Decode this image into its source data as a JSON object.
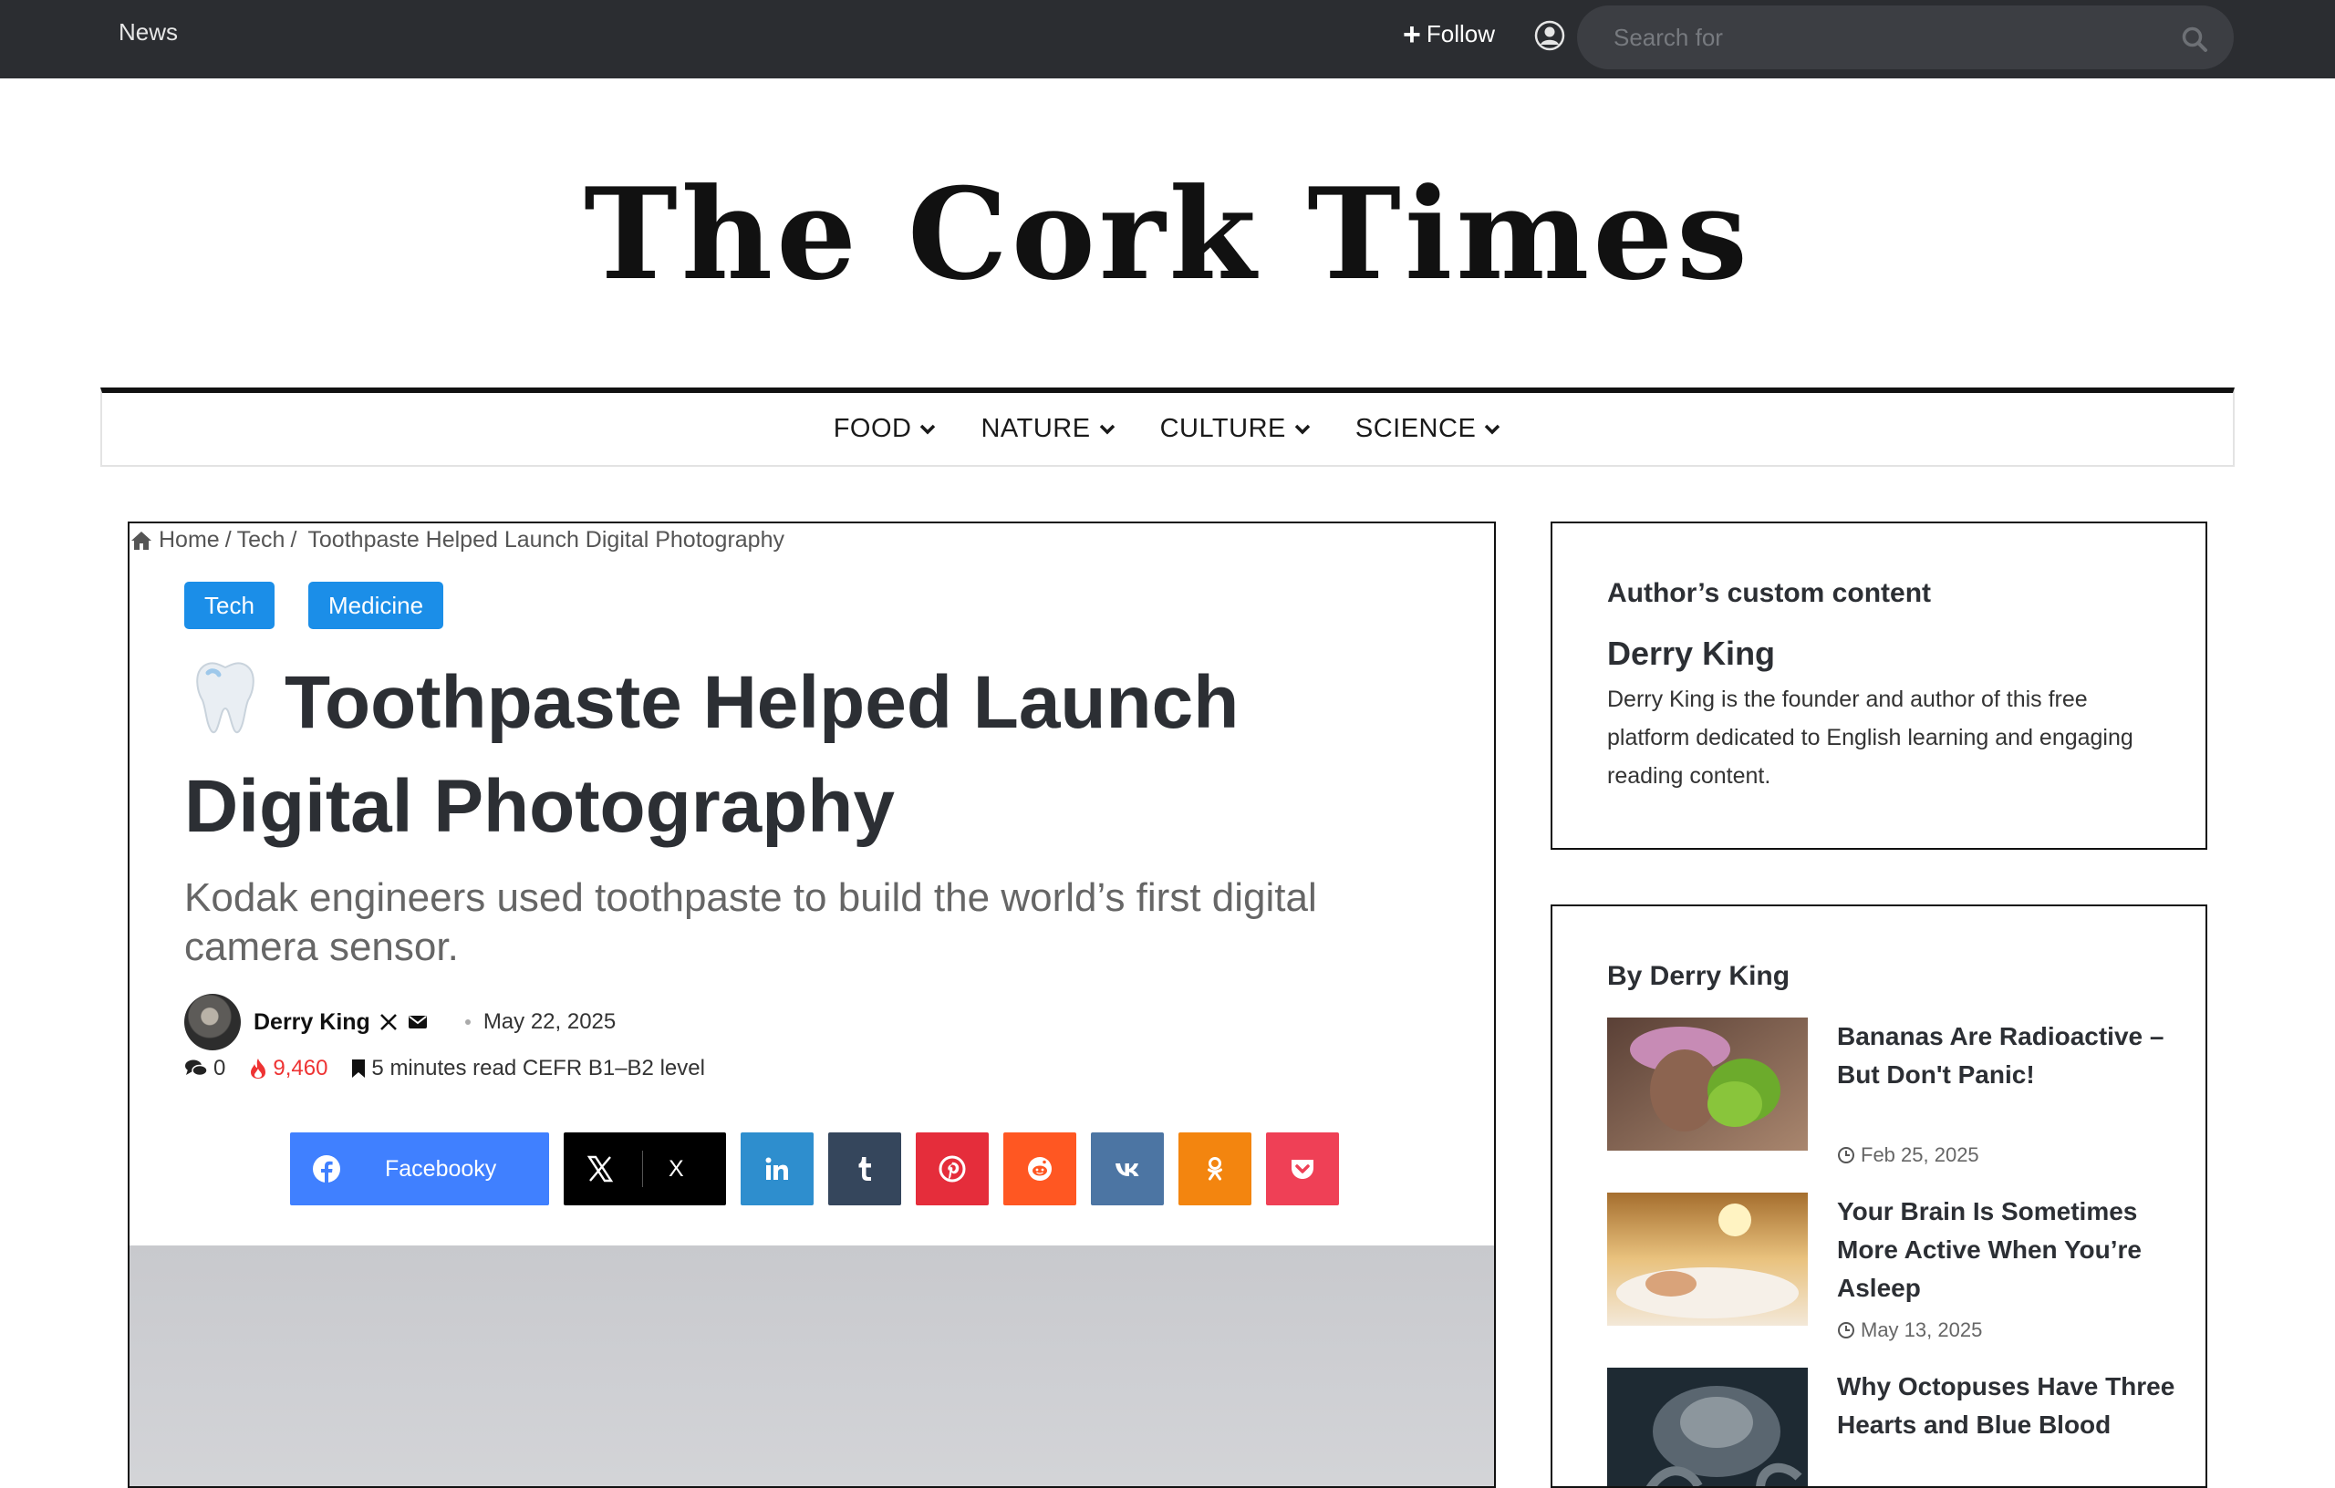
{
  "topbar": {
    "news_label": "News",
    "follow_label": "Follow",
    "search_placeholder": "Search for"
  },
  "site": {
    "logo_text": "The Cork Times"
  },
  "nav": {
    "items": [
      {
        "label": "FOOD"
      },
      {
        "label": "NATURE"
      },
      {
        "label": "CULTURE"
      },
      {
        "label": "SCIENCE"
      }
    ]
  },
  "breadcrumb": {
    "home": "Home",
    "sep1": "/",
    "section": "Tech",
    "sep2": "/",
    "current": "Toothpaste Helped Launch Digital Photography"
  },
  "article": {
    "tags": [
      "Tech",
      "Medicine"
    ],
    "title": "Toothpaste Helped Launch Digital Photography",
    "subtitle": "Kodak engineers used toothpaste to build the world’s first digital camera sensor.",
    "author": "Derry King",
    "date": "May 22, 2025",
    "comments": "0",
    "views": "9,460",
    "read_time": "5 minutes read CEFR B1–B2 level",
    "share": {
      "facebook_label": "Facebooky",
      "x_label": "X"
    }
  },
  "colors": {
    "topbar_bg": "#2b2d31",
    "tag_blue": "#1b8ee8",
    "facebook": "#4080ff",
    "x": "#000000",
    "linkedin": "#2e8ece",
    "tumblr": "#35465c",
    "pinterest": "#e52d3b",
    "reddit": "#ff5722",
    "vk": "#4c75a3",
    "odnoklassniki": "#f3850f",
    "pocket": "#ef4056",
    "views_red": "#ee3333"
  },
  "sidebar": {
    "author_widget": {
      "title": "Author’s custom content",
      "name": "Derry King",
      "bio": "Derry King is the founder and author of this free platform dedicated to English learning and engaging reading content."
    },
    "posts_widget": {
      "title": "By Derry King",
      "posts": [
        {
          "title": "Bananas Are Radioactive – But Don't Panic!",
          "date": "Feb 25, 2025"
        },
        {
          "title": "Your Brain Is Sometimes More Active When You’re Asleep",
          "date": "May 13, 2025"
        },
        {
          "title": "Why Octopuses Have Three Hearts and Blue Blood",
          "date": ""
        }
      ]
    }
  }
}
